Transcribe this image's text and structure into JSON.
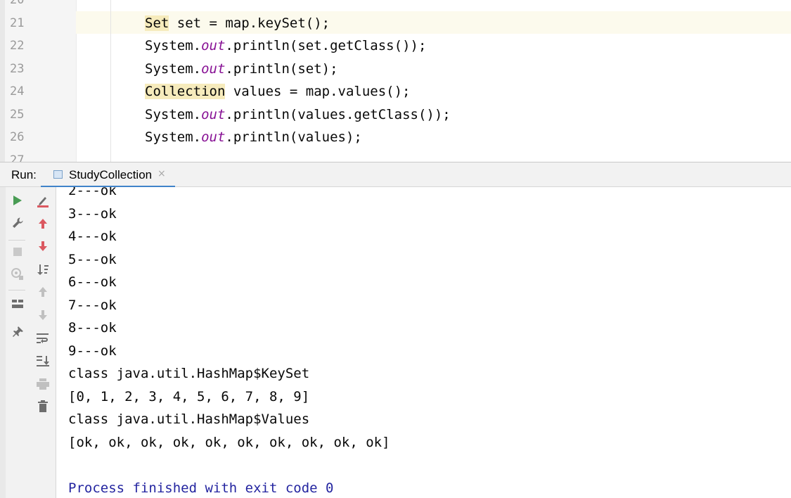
{
  "editor": {
    "lines": [
      {
        "num": "20",
        "segments": []
      },
      {
        "num": "21",
        "segments": [
          {
            "t": "Set",
            "c": "hl"
          },
          {
            "t": " set = map.keySet();",
            "c": ""
          }
        ]
      },
      {
        "num": "22",
        "segments": [
          {
            "t": "System.",
            "c": ""
          },
          {
            "t": "out",
            "c": "kw-out"
          },
          {
            "t": ".println(set.getClass());",
            "c": ""
          }
        ]
      },
      {
        "num": "23",
        "segments": [
          {
            "t": "System.",
            "c": ""
          },
          {
            "t": "out",
            "c": "kw-out"
          },
          {
            "t": ".println(set);",
            "c": ""
          }
        ]
      },
      {
        "num": "24",
        "segments": [
          {
            "t": "Collection",
            "c": "hl"
          },
          {
            "t": " values = map.values();",
            "c": ""
          }
        ]
      },
      {
        "num": "25",
        "segments": [
          {
            "t": "System.",
            "c": ""
          },
          {
            "t": "out",
            "c": "kw-out"
          },
          {
            "t": ".println(values.getClass());",
            "c": ""
          }
        ]
      },
      {
        "num": "26",
        "segments": [
          {
            "t": "System.",
            "c": ""
          },
          {
            "t": "out",
            "c": "kw-out"
          },
          {
            "t": ".println(values);",
            "c": ""
          }
        ]
      },
      {
        "num": "27",
        "segments": []
      }
    ]
  },
  "run_panel": {
    "label": "Run:",
    "tab": {
      "name": "StudyCollection",
      "close": "×"
    }
  },
  "left_toolbar": [
    {
      "name": "rerun-icon"
    },
    {
      "name": "wrench-icon"
    },
    {
      "name": "stop-icon"
    },
    {
      "name": "camera-snapshot-icon"
    },
    {
      "name": "layout-icon"
    },
    {
      "name": "pin-icon"
    }
  ],
  "second_toolbar": [
    {
      "name": "edit-configuration-icon"
    },
    {
      "name": "up-arrow-icon"
    },
    {
      "name": "down-arrow-icon"
    },
    {
      "name": "sort-icon"
    },
    {
      "name": "previous-occurrence-icon"
    },
    {
      "name": "next-occurrence-icon"
    },
    {
      "name": "soft-wrap-icon"
    },
    {
      "name": "scroll-to-end-icon"
    },
    {
      "name": "print-icon"
    },
    {
      "name": "trash-icon"
    }
  ],
  "console": {
    "lines": [
      {
        "text": "2---ok",
        "kind": "out"
      },
      {
        "text": "3---ok",
        "kind": "out"
      },
      {
        "text": "4---ok",
        "kind": "out"
      },
      {
        "text": "5---ok",
        "kind": "out"
      },
      {
        "text": "6---ok",
        "kind": "out"
      },
      {
        "text": "7---ok",
        "kind": "out"
      },
      {
        "text": "8---ok",
        "kind": "out"
      },
      {
        "text": "9---ok",
        "kind": "out"
      },
      {
        "text": "class java.util.HashMap$KeySet",
        "kind": "out"
      },
      {
        "text": "[0, 1, 2, 3, 4, 5, 6, 7, 8, 9]",
        "kind": "out"
      },
      {
        "text": "class java.util.HashMap$Values",
        "kind": "out"
      },
      {
        "text": "[ok, ok, ok, ok, ok, ok, ok, ok, ok, ok]",
        "kind": "out"
      },
      {
        "text": "",
        "kind": "out"
      },
      {
        "text": "Process finished with exit code 0",
        "kind": "sys"
      }
    ]
  },
  "colors": {
    "accent": "#4083c9",
    "green": "#499c54",
    "red": "#db5860",
    "gray_icon": "#6e6e6e",
    "system_text": "#2425a0",
    "out_keyword": "#871094",
    "usage_highlight": "#f6ebbc"
  }
}
